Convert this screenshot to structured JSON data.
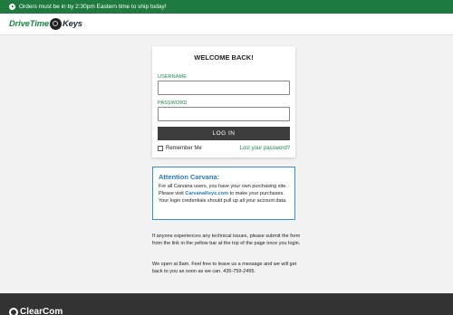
{
  "banner": {
    "icon": "clock-icon",
    "text": "Orders must be in by 2:30pm Eastern time to ship today!"
  },
  "header": {
    "logo_part1": "DriveTime",
    "logo_icon": "key-icon",
    "logo_part2": "Keys"
  },
  "login": {
    "title": "WELCOME BACK!",
    "username_label": "USERNAME",
    "username_value": "",
    "password_label": "PASSWORD",
    "password_value": "",
    "button_label": "LOG IN",
    "remember_label": "Remember Me",
    "lost_password": "Lost your password?"
  },
  "notice": {
    "title": "Attention Carvana:",
    "text_before": "For all Carvana users, you have your own purchasing site. Please visit ",
    "link": "CarvanaKeys.com",
    "text_after": " to make your purchases. Your login credentials should pull up all your account data."
  },
  "info": {
    "paragraph1": "If anyone experiences any technical issues, please submit the form from the link in the yellow bar at the top of the page once you login.",
    "paragraph2": "We open at 8am. Feel free to leave us a message and we will get back to you as soon as we can. 435-759-2495."
  },
  "footer": {
    "logo_text": "ClearCom"
  },
  "colors": {
    "brand_green": "#1f7a3f",
    "link_blue": "#2a79c2",
    "button_dark": "#3d3d3d",
    "footer_dark": "#333333"
  }
}
